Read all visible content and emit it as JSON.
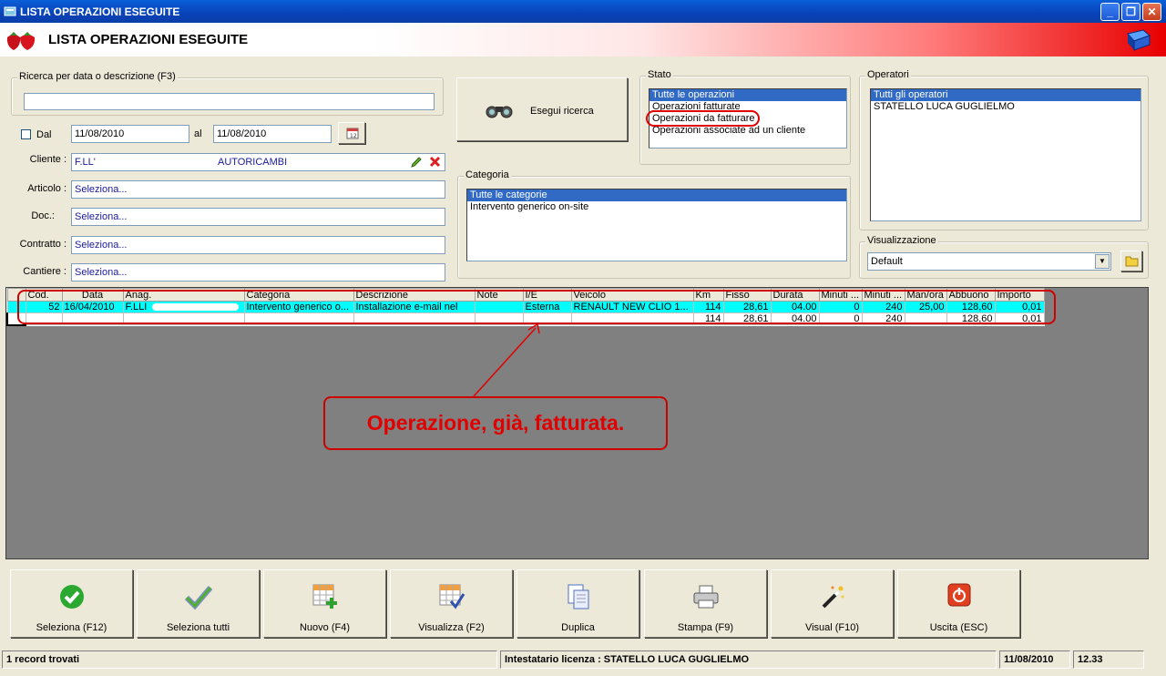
{
  "window": {
    "title": "LISTA OPERAZIONI ESEGUITE",
    "header_title": "LISTA OPERAZIONI ESEGUITE",
    "controls": {
      "minimize": "_",
      "maximize": "❐",
      "close": "✕"
    }
  },
  "search": {
    "group_label": "Ricerca per data o descrizione (F3)",
    "query_value": "",
    "dal_label": "Dal",
    "dal_checked": false,
    "date_from": "11/08/2010",
    "al_label": "al",
    "date_to": "11/08/2010",
    "cliente_label": "Cliente :",
    "cliente_value": "F.LL'",
    "cliente_value2": "AUTORICAMBI",
    "articolo_label": "Articolo :",
    "articolo_value": "Seleziona...",
    "doc_label": "Doc.:",
    "doc_value": "Seleziona...",
    "contratto_label": "Contratto :",
    "contratto_value": "Seleziona...",
    "cantiere_label": "Cantiere :",
    "cantiere_value": "Seleziona...",
    "execute_button": "Esegui ricerca"
  },
  "stato": {
    "label": "Stato",
    "items": [
      "Tutte le operazioni",
      "Operazioni fatturate",
      "Operazioni da fatturare",
      "Operazioni associate ad un cliente"
    ],
    "selected_index": 0,
    "circled_index": 2
  },
  "categoria": {
    "label": "Categoria",
    "items": [
      "Tutte le categorie",
      "Intervento generico on-site"
    ],
    "selected_index": 0
  },
  "operatori": {
    "label": "Operatori",
    "items": [
      "Tutti gli operatori",
      "STATELLO LUCA GUGLIELMO"
    ],
    "selected_index": 0
  },
  "visualizzazione": {
    "label": "Visualizzazione",
    "selected": "Default"
  },
  "grid": {
    "columns": [
      "Cod.",
      "Data",
      "Anag.",
      "Categoria",
      "Descrizione",
      "Note",
      "I/E",
      "Veicolo",
      "Km",
      "Fisso",
      "Durata",
      "Minuti ...",
      "Minuti ...",
      "Man/ora",
      "Abbuono",
      "Importo"
    ],
    "rows": [
      [
        "52",
        "16/04/2010",
        "F.LLI",
        "Intervento generico o...",
        "Installazione e-mail nel",
        "",
        "Esterna",
        "RENAULT NEW CLIO 1...",
        "114",
        "28,61",
        "04.00",
        "0",
        "240",
        "25,00",
        "128,60",
        "0,01"
      ]
    ],
    "totals": [
      "",
      "",
      "",
      "",
      "",
      "",
      "",
      "",
      "114",
      "28,61",
      "04.00",
      "0",
      "240",
      "",
      "128,60",
      "0,01"
    ]
  },
  "annotation": {
    "text": "Operazione, già, fatturata.",
    "color": "#e00000"
  },
  "buttons": [
    {
      "label": "Seleziona (F12)",
      "icon": "check-circle-icon"
    },
    {
      "label": "Seleziona tutti",
      "icon": "checkmark-icon"
    },
    {
      "label": "Nuovo (F4)",
      "icon": "new-grid-icon"
    },
    {
      "label": "Visualizza (F2)",
      "icon": "view-grid-icon"
    },
    {
      "label": "Duplica",
      "icon": "duplicate-icon"
    },
    {
      "label": "Stampa (F9)",
      "icon": "printer-icon"
    },
    {
      "label": "Visual (F10)",
      "icon": "magic-wand-icon"
    },
    {
      "label": "Uscita (ESC)",
      "icon": "power-icon"
    }
  ],
  "status": {
    "records": "1 record trovati",
    "license": "Intestatario licenza : STATELLO LUCA GUGLIELMO",
    "date": "11/08/2010",
    "time": "12.33"
  }
}
